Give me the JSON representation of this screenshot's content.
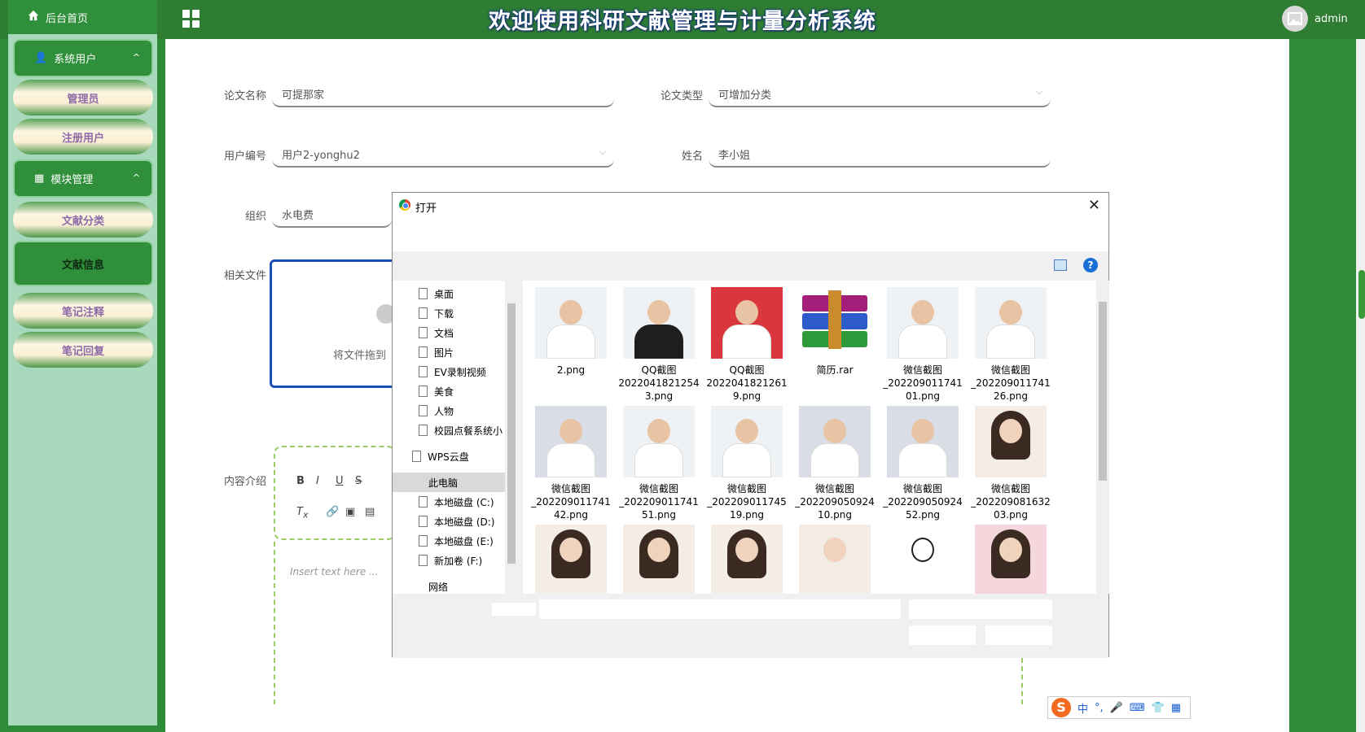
{
  "app": {
    "title": "欢迎使用科研文献管理与计量分析系统",
    "user": "admin"
  },
  "sidebar": {
    "home": "后台首页",
    "groups": [
      {
        "label": "系统用户",
        "items": [
          "管理员",
          "注册用户"
        ]
      },
      {
        "label": "模块管理",
        "items": [
          "文献分类",
          "文献信息",
          "笔记注释",
          "笔记回复"
        ]
      }
    ],
    "active_item": "文献信息"
  },
  "form": {
    "paper_name_label": "论文名称",
    "paper_name_value": "可提那家",
    "paper_type_label": "论文类型",
    "paper_type_value": "可增加分类",
    "user_no_label": "用户编号",
    "user_no_value": "用户2-yonghu2",
    "name_label": "姓名",
    "name_value": "李小姐",
    "org_label": "组织",
    "org_value": "水电费",
    "file_label": "相关文件",
    "upload_hint": "将文件拖到",
    "intro_label": "内容介绍",
    "editor_placeholder": "Insert text here ..."
  },
  "editor_toolbar": {
    "row1": [
      "B",
      "I",
      "U",
      "S"
    ],
    "row2": [
      "Tx",
      "link",
      "image",
      "film"
    ]
  },
  "dialog": {
    "title": "打开",
    "nav_items": [
      {
        "label": "桌面",
        "pinned": true
      },
      {
        "label": "下载",
        "pinned": true
      },
      {
        "label": "文档",
        "pinned": true
      },
      {
        "label": "图片",
        "pinned": true
      },
      {
        "label": "EV录制视频",
        "pinned": false
      },
      {
        "label": "美食",
        "pinned": false
      },
      {
        "label": "人物",
        "pinned": false
      },
      {
        "label": "校园点餐系统小",
        "pinned": false
      }
    ],
    "wps": "WPS云盘",
    "this_pc": "此电脑",
    "drives": [
      "本地磁盘 (C:)",
      "本地磁盘 (D:)",
      "本地磁盘 (E:)",
      "新加卷 (F:)"
    ],
    "network": "网络",
    "files": [
      {
        "name": "2.png",
        "thumb": "doctor"
      },
      {
        "name": "QQ截图2022041821254 3.png",
        "line1": "QQ截图",
        "line2": "2022041821254",
        "line3": "3.png",
        "thumb": "dark"
      },
      {
        "line1": "QQ截图",
        "line2": "2022041821261",
        "line3": "9.png",
        "thumb": "red"
      },
      {
        "name": "简历.rar",
        "thumb": "rar"
      },
      {
        "line1": "微信截图",
        "line2": "_202209011741",
        "line3": "01.png",
        "thumb": "doctor"
      },
      {
        "line1": "微信截图",
        "line2": "_202209011741",
        "line3": "26.png",
        "thumb": "doctor"
      },
      {
        "line1": "微信截图",
        "line2": "_202209011741",
        "line3": "42.png",
        "thumb": "hospital"
      },
      {
        "line1": "微信截图",
        "line2": "_202209011741",
        "line3": "51.png",
        "thumb": "doctor"
      },
      {
        "line1": "微信截图",
        "line2": "_202209011745",
        "line3": "19.png",
        "thumb": "doctor"
      },
      {
        "line1": "微信截图",
        "line2": "_202209050924",
        "line3": "10.png",
        "thumb": "hospital"
      },
      {
        "line1": "微信截图",
        "line2": "_202209050924",
        "line3": "52.png",
        "thumb": "hospital"
      },
      {
        "line1": "微信截图",
        "line2": "_202209081632",
        "line3": "03.png",
        "thumb": "portrait"
      }
    ]
  },
  "ime": {
    "label": "中",
    "icons": [
      "punct-icon",
      "mic-icon",
      "keyboard-icon",
      "skin-icon",
      "grid-icon"
    ]
  }
}
